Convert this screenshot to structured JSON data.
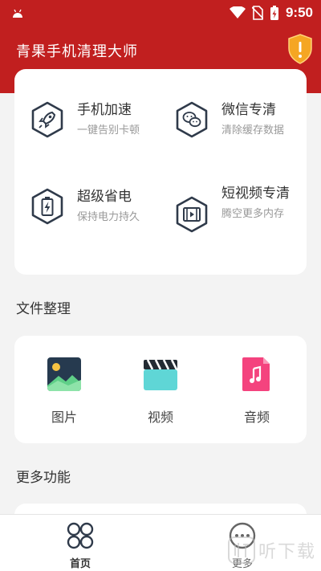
{
  "status_bar": {
    "time": "9:50"
  },
  "app_bar": {
    "title": "青果手机清理大师"
  },
  "features": [
    {
      "title": "手机加速",
      "subtitle": "一键告别卡顿",
      "icon": "rocket-icon"
    },
    {
      "title": "微信专清",
      "subtitle": "清除缓存数据",
      "icon": "wechat-icon"
    },
    {
      "title": "超级省电",
      "subtitle": "保持电力持久",
      "icon": "battery-icon"
    },
    {
      "title": "短视频专清",
      "subtitle": "腾空更多内存",
      "icon": "video-icon"
    }
  ],
  "file_section": {
    "title": "文件整理",
    "items": [
      {
        "label": "图片",
        "icon": "image-icon"
      },
      {
        "label": "视频",
        "icon": "clapperboard-icon"
      },
      {
        "label": "音频",
        "icon": "music-file-icon"
      }
    ]
  },
  "more_section": {
    "title": "更多功能"
  },
  "bottom_nav": [
    {
      "label": "首页",
      "icon": "home-icon",
      "active": true
    },
    {
      "label": "更多",
      "icon": "more-icon",
      "active": false
    }
  ],
  "watermark": {
    "text": "听下载"
  },
  "colors": {
    "primary": "#c11f1f",
    "accent_orange": "#f5a623",
    "icon_dark": "#2f3a4a"
  }
}
